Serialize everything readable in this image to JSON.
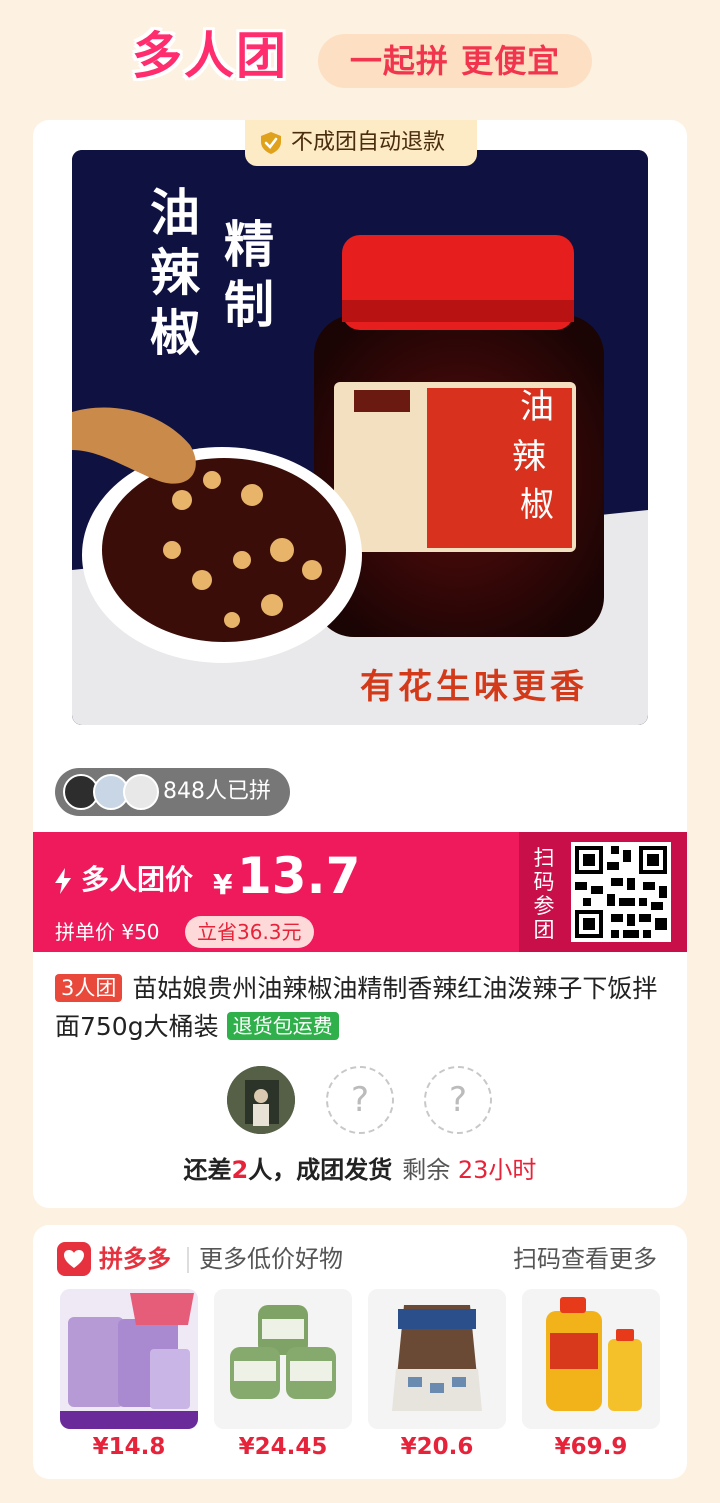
{
  "header": {
    "logo_text": "多人团",
    "slogan": "一起拼 更便宜"
  },
  "badge": {
    "icon": "shield-check-icon",
    "text": "不成团自动退款"
  },
  "product_image": {
    "text_left": "油辣椒",
    "text_right": "精制",
    "caption": "有花生味更香",
    "jar_label": "油辣椒"
  },
  "joined": {
    "text": "848人已拼"
  },
  "price": {
    "label": "多人团价",
    "currency": "¥",
    "amount": "13.7",
    "single_price": "拼单价 ¥50",
    "saving": "立省36.3元",
    "scan_label": "扫码参团"
  },
  "product": {
    "group_tag": "3人团",
    "title": "苗姑娘贵州油辣椒油精制香辣红油泼辣子下饭拌面750g大桶装",
    "shipping_tag": "退货包运费"
  },
  "group": {
    "empty_mark": "?",
    "status_prefix": "还差",
    "status_count": "2",
    "status_suffix": "人，成团发货",
    "remain_label": "剩余",
    "remain_time": "23小时"
  },
  "recommend": {
    "brand": "拼多多",
    "subtitle": "更多低价好物",
    "action": "扫码查看更多",
    "items": [
      {
        "price": "¥14.8"
      },
      {
        "price": "¥24.45"
      },
      {
        "price": "¥20.6"
      },
      {
        "price": "¥69.9"
      }
    ]
  },
  "colors": {
    "page_bg": "#fdf1e1",
    "accent": "#ef1a5b",
    "price_red": "#e5233a",
    "green_tag": "#2fb04a"
  }
}
